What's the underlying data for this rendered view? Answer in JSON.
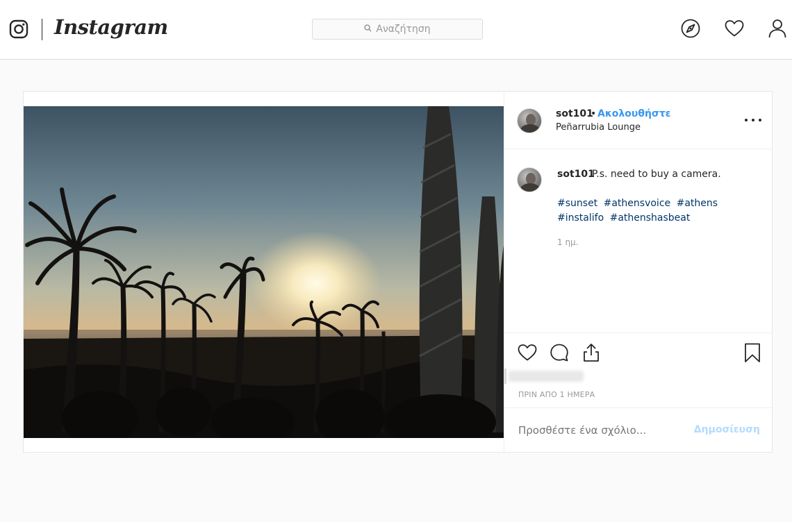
{
  "topnav": {
    "wordmark": "Instagram",
    "search_placeholder": "Αναζήτηση",
    "icons": [
      "instagram-glyph-icon",
      "compass-icon",
      "heart-icon",
      "profile-icon"
    ]
  },
  "post": {
    "header": {
      "username": "sot101",
      "separator": "•",
      "follow_label": "Ακολουθήστε",
      "location": "Peñarrubia Lounge"
    },
    "caption": {
      "username": "sot101",
      "text": "P.s. need to buy a camera.",
      "hashtags": [
        "#sunset",
        "#athensvoice",
        "#athens",
        "#instalifo",
        "#athenshasbeat"
      ],
      "time_ago": "1 ημ."
    },
    "actions": {
      "icons": [
        "like-heart-icon",
        "comment-icon",
        "share-icon",
        "save-bookmark-icon"
      ],
      "likes_text_blurred": "",
      "timestamp": "ΠΡΙΝ ΑΠΟ 1 ΗΜΕΡΑ"
    },
    "comment_box": {
      "placeholder": "Προσθέστε ένα σχόλιο...",
      "publish_label": "Δημοσίευση"
    }
  },
  "colors": {
    "link_blue": "#3897f0",
    "hashtag": "#003569",
    "muted": "#999999",
    "border": "#dbdbdb",
    "background": "#fafafa"
  }
}
